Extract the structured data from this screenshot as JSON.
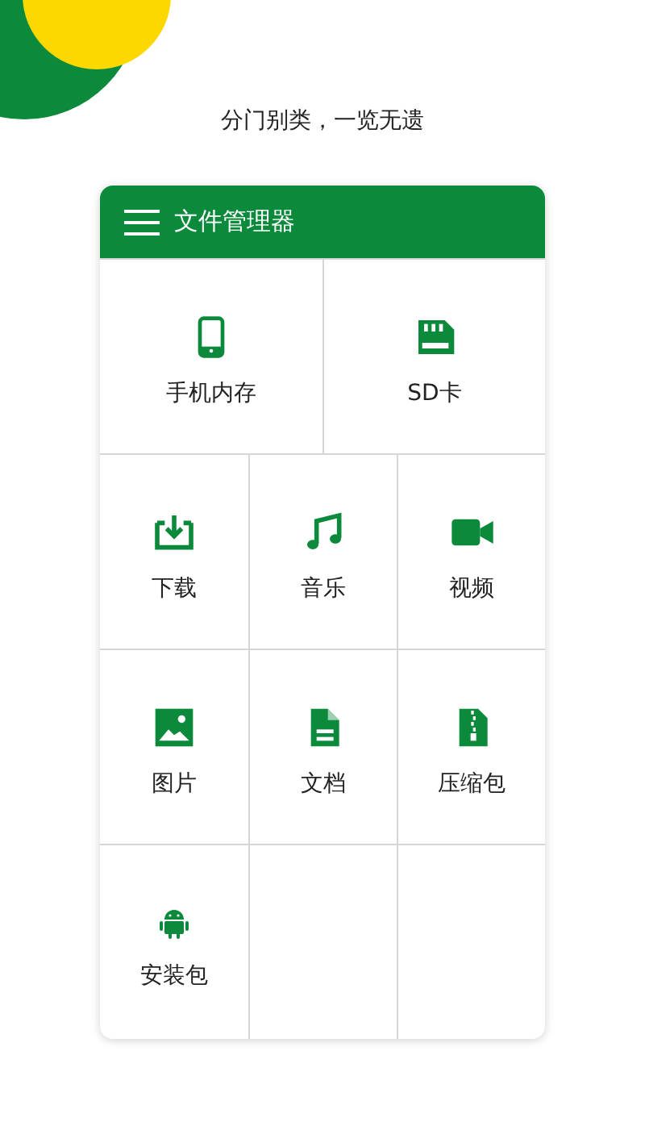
{
  "caption": "分门别类，一览无遗",
  "toolbar": {
    "title": "文件管理器"
  },
  "rows": [
    {
      "cells": [
        {
          "label": "手机内存",
          "kind": "phone"
        },
        {
          "label": "SD卡",
          "kind": "sdcard"
        }
      ]
    },
    {
      "cells": [
        {
          "label": "下载",
          "kind": "download"
        },
        {
          "label": "音乐",
          "kind": "music"
        },
        {
          "label": "视频",
          "kind": "video"
        }
      ]
    },
    {
      "cells": [
        {
          "label": "图片",
          "kind": "image"
        },
        {
          "label": "文档",
          "kind": "document"
        },
        {
          "label": "压缩包",
          "kind": "archive"
        }
      ]
    },
    {
      "cells": [
        {
          "label": "安装包",
          "kind": "android"
        }
      ]
    }
  ]
}
